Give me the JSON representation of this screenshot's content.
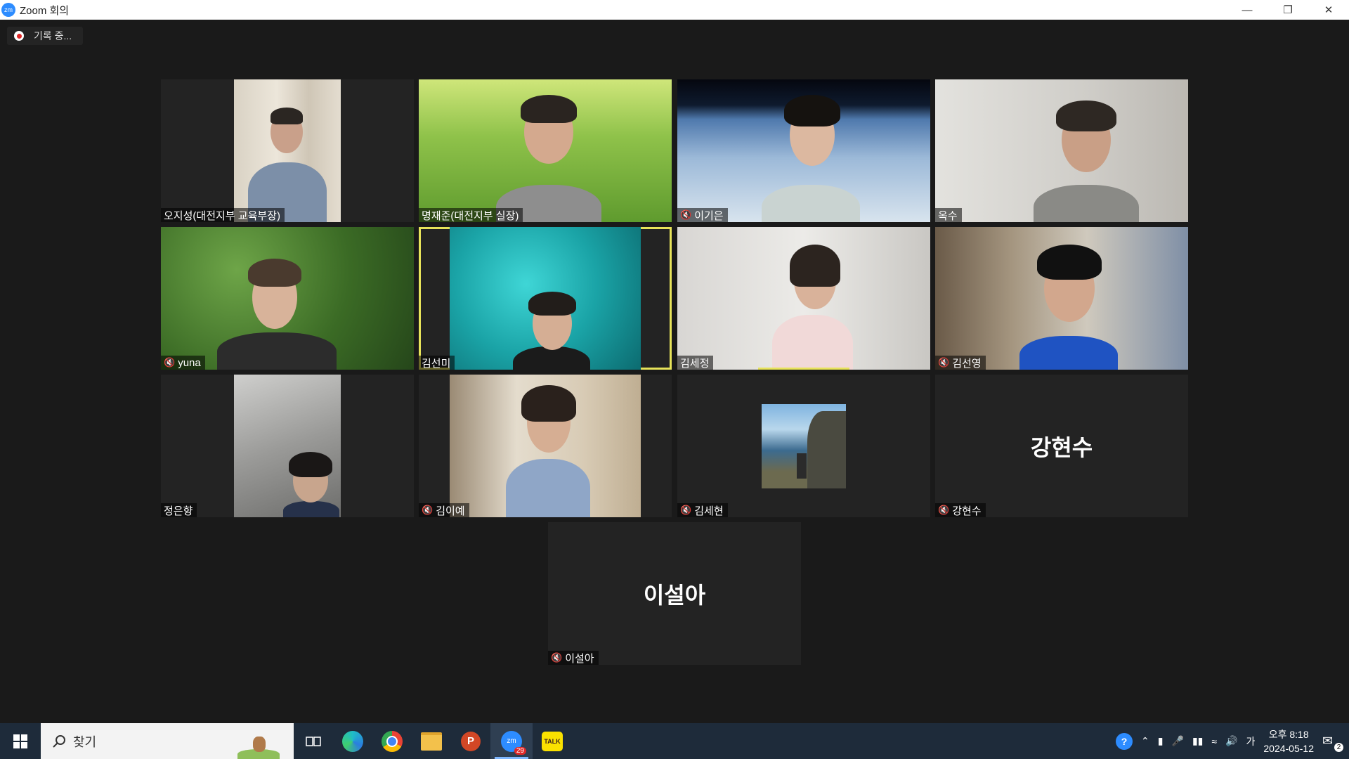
{
  "window": {
    "title": "Zoom 회의",
    "controls": [
      "minimize",
      "restore",
      "close"
    ]
  },
  "recording": {
    "label": "기록 중..."
  },
  "participants": [
    {
      "name": "오지성(대전지부 교육부장)",
      "muted": false
    },
    {
      "name": "명재준(대전지부 실장)",
      "muted": false
    },
    {
      "name": "이기은",
      "muted": true
    },
    {
      "name": "옥수",
      "muted": false
    },
    {
      "name": "yuna",
      "muted": true
    },
    {
      "name": "김선미",
      "muted": false,
      "active_speaker": true
    },
    {
      "name": "김세정",
      "muted": false
    },
    {
      "name": "김선영",
      "muted": true
    },
    {
      "name": "정은향",
      "muted": false
    },
    {
      "name": "김이예",
      "muted": true
    },
    {
      "name": "김세현",
      "muted": true
    },
    {
      "name": "강현수",
      "muted": true,
      "video_off": true,
      "display_name": "강현수"
    },
    {
      "name": "이설아",
      "muted": true,
      "video_off": true,
      "display_name": "이설아"
    }
  ],
  "taskbar": {
    "search_placeholder": "찾기",
    "apps": [
      "task-view",
      "edge",
      "chrome",
      "file-explorer",
      "powerpoint",
      "zoom",
      "kakaotalk"
    ],
    "zoom_badge": "29",
    "ime": "가",
    "time": "오후 8:18",
    "date": "2024-05-12",
    "notification_count": "2"
  }
}
